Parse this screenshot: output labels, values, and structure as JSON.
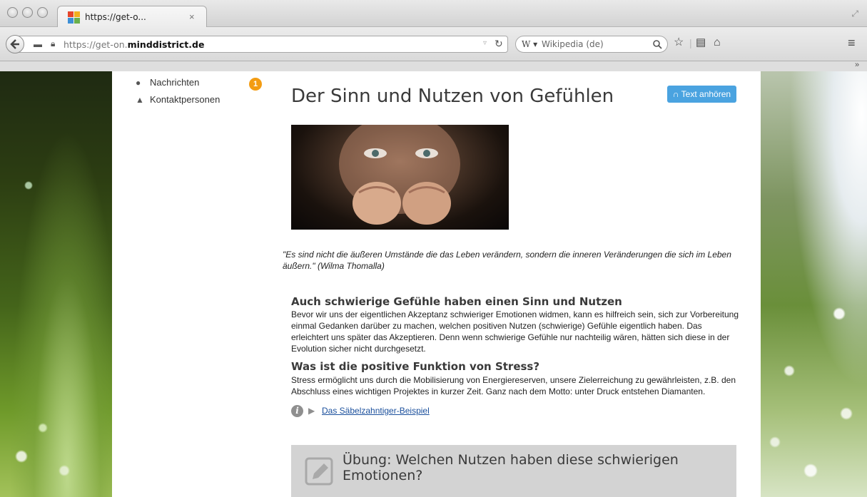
{
  "browser": {
    "tab_title": "https://get-o...",
    "tab_close": "×",
    "url_prefix": "https://get-on.",
    "url_domain": "minddistrict.de",
    "search_engine": "W ▾",
    "search_placeholder": "Wikipedia (de)"
  },
  "sidebar": {
    "items": [
      {
        "label": "Nachrichten",
        "icon": "chat-bubble-icon"
      },
      {
        "label": "Kontaktpersonen",
        "icon": "person-icon"
      }
    ],
    "badge_count": "1"
  },
  "main": {
    "title": "Der Sinn und Nutzen von Gefühlen",
    "listen_button": "Text anhören",
    "quote": "\"Es sind nicht die äußeren Umstände die das Leben verändern, sondern die inneren Veränderungen die sich im Leben äußern.\" (Wilma Thomalla)",
    "section1_heading": "Auch schwierige Gefühle haben einen Sinn und Nutzen",
    "section1_text": "Bevor wir uns der eigentlichen Akzeptanz schwieriger Emotionen widmen, kann es hilfreich sein, sich zur Vorbereitung einmal Gedanken darüber zu machen, welchen positiven Nutzen (schwierige) Gefühle eigentlich haben. Das erleichtert uns später das Akzeptieren. Denn wenn schwierige Gefühle nur nachteilig wären, hätten sich diese in der Evolution sicher nicht durchgesetzt.",
    "section2_heading": "Was ist die positive Funktion von Stress?",
    "section2_text": "Stress ermöglicht uns durch die Mobilisierung von Energiereserven, unsere Zielerreichung zu gewährleisten, z.B. den Abschluss eines wichtigen Projektes in kurzer Zeit. Ganz nach dem Motto: unter Druck entstehen Diamanten.",
    "info_link": "Das Säbelzahntiger-Beispiel",
    "exercise_title": "Übung: Welchen Nutzen haben diese schwierigen Emotionen?"
  },
  "colors": {
    "accent_button": "#4aa3e0",
    "badge": "#f39c12",
    "link": "#1a4f9c",
    "exercise_bg": "#d3d3d3"
  }
}
